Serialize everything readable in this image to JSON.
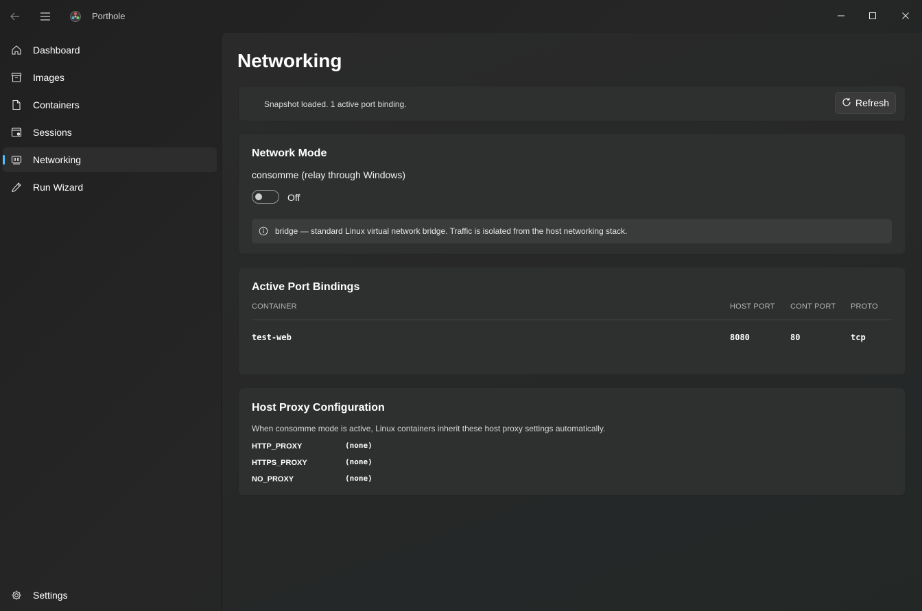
{
  "app": {
    "title": "Porthole"
  },
  "window_controls": {
    "minimize": "minimize-icon",
    "maximize": "maximize-icon",
    "close": "close-icon"
  },
  "sidebar": {
    "items": [
      {
        "label": "Dashboard",
        "icon": "home-icon"
      },
      {
        "label": "Images",
        "icon": "archive-icon"
      },
      {
        "label": "Containers",
        "icon": "document-icon"
      },
      {
        "label": "Sessions",
        "icon": "window-icon"
      },
      {
        "label": "Networking",
        "icon": "network-icon",
        "selected": true
      },
      {
        "label": "Run Wizard",
        "icon": "pencil-icon"
      }
    ],
    "settings": {
      "label": "Settings",
      "icon": "gear-icon"
    }
  },
  "page": {
    "title": "Networking"
  },
  "status": {
    "text": "Snapshot loaded. 1 active port binding.",
    "refresh_label": "Refresh"
  },
  "network_mode": {
    "title": "Network Mode",
    "mode_label": "consomme (relay through Windows)",
    "toggle_state": "Off",
    "info_text": "bridge — standard Linux virtual network bridge. Traffic is isolated from the host networking stack."
  },
  "port_bindings": {
    "title": "Active Port Bindings",
    "columns": [
      "CONTAINER",
      "HOST PORT",
      "CONT PORT",
      "PROTO"
    ],
    "rows": [
      {
        "container": "test-web",
        "host_port": "8080",
        "cont_port": "80",
        "proto": "tcp"
      }
    ]
  },
  "proxy": {
    "title": "Host Proxy Configuration",
    "description": "When consomme mode is active, Linux containers inherit these host proxy settings automatically.",
    "entries": [
      {
        "key": "HTTP_PROXY",
        "value": "(none)"
      },
      {
        "key": "HTTPS_PROXY",
        "value": "(none)"
      },
      {
        "key": "NO_PROXY",
        "value": "(none)"
      }
    ]
  },
  "colors": {
    "accent": "#4cc2ff",
    "card": "#2e2f2f",
    "sidebar_bg": "#202020"
  }
}
